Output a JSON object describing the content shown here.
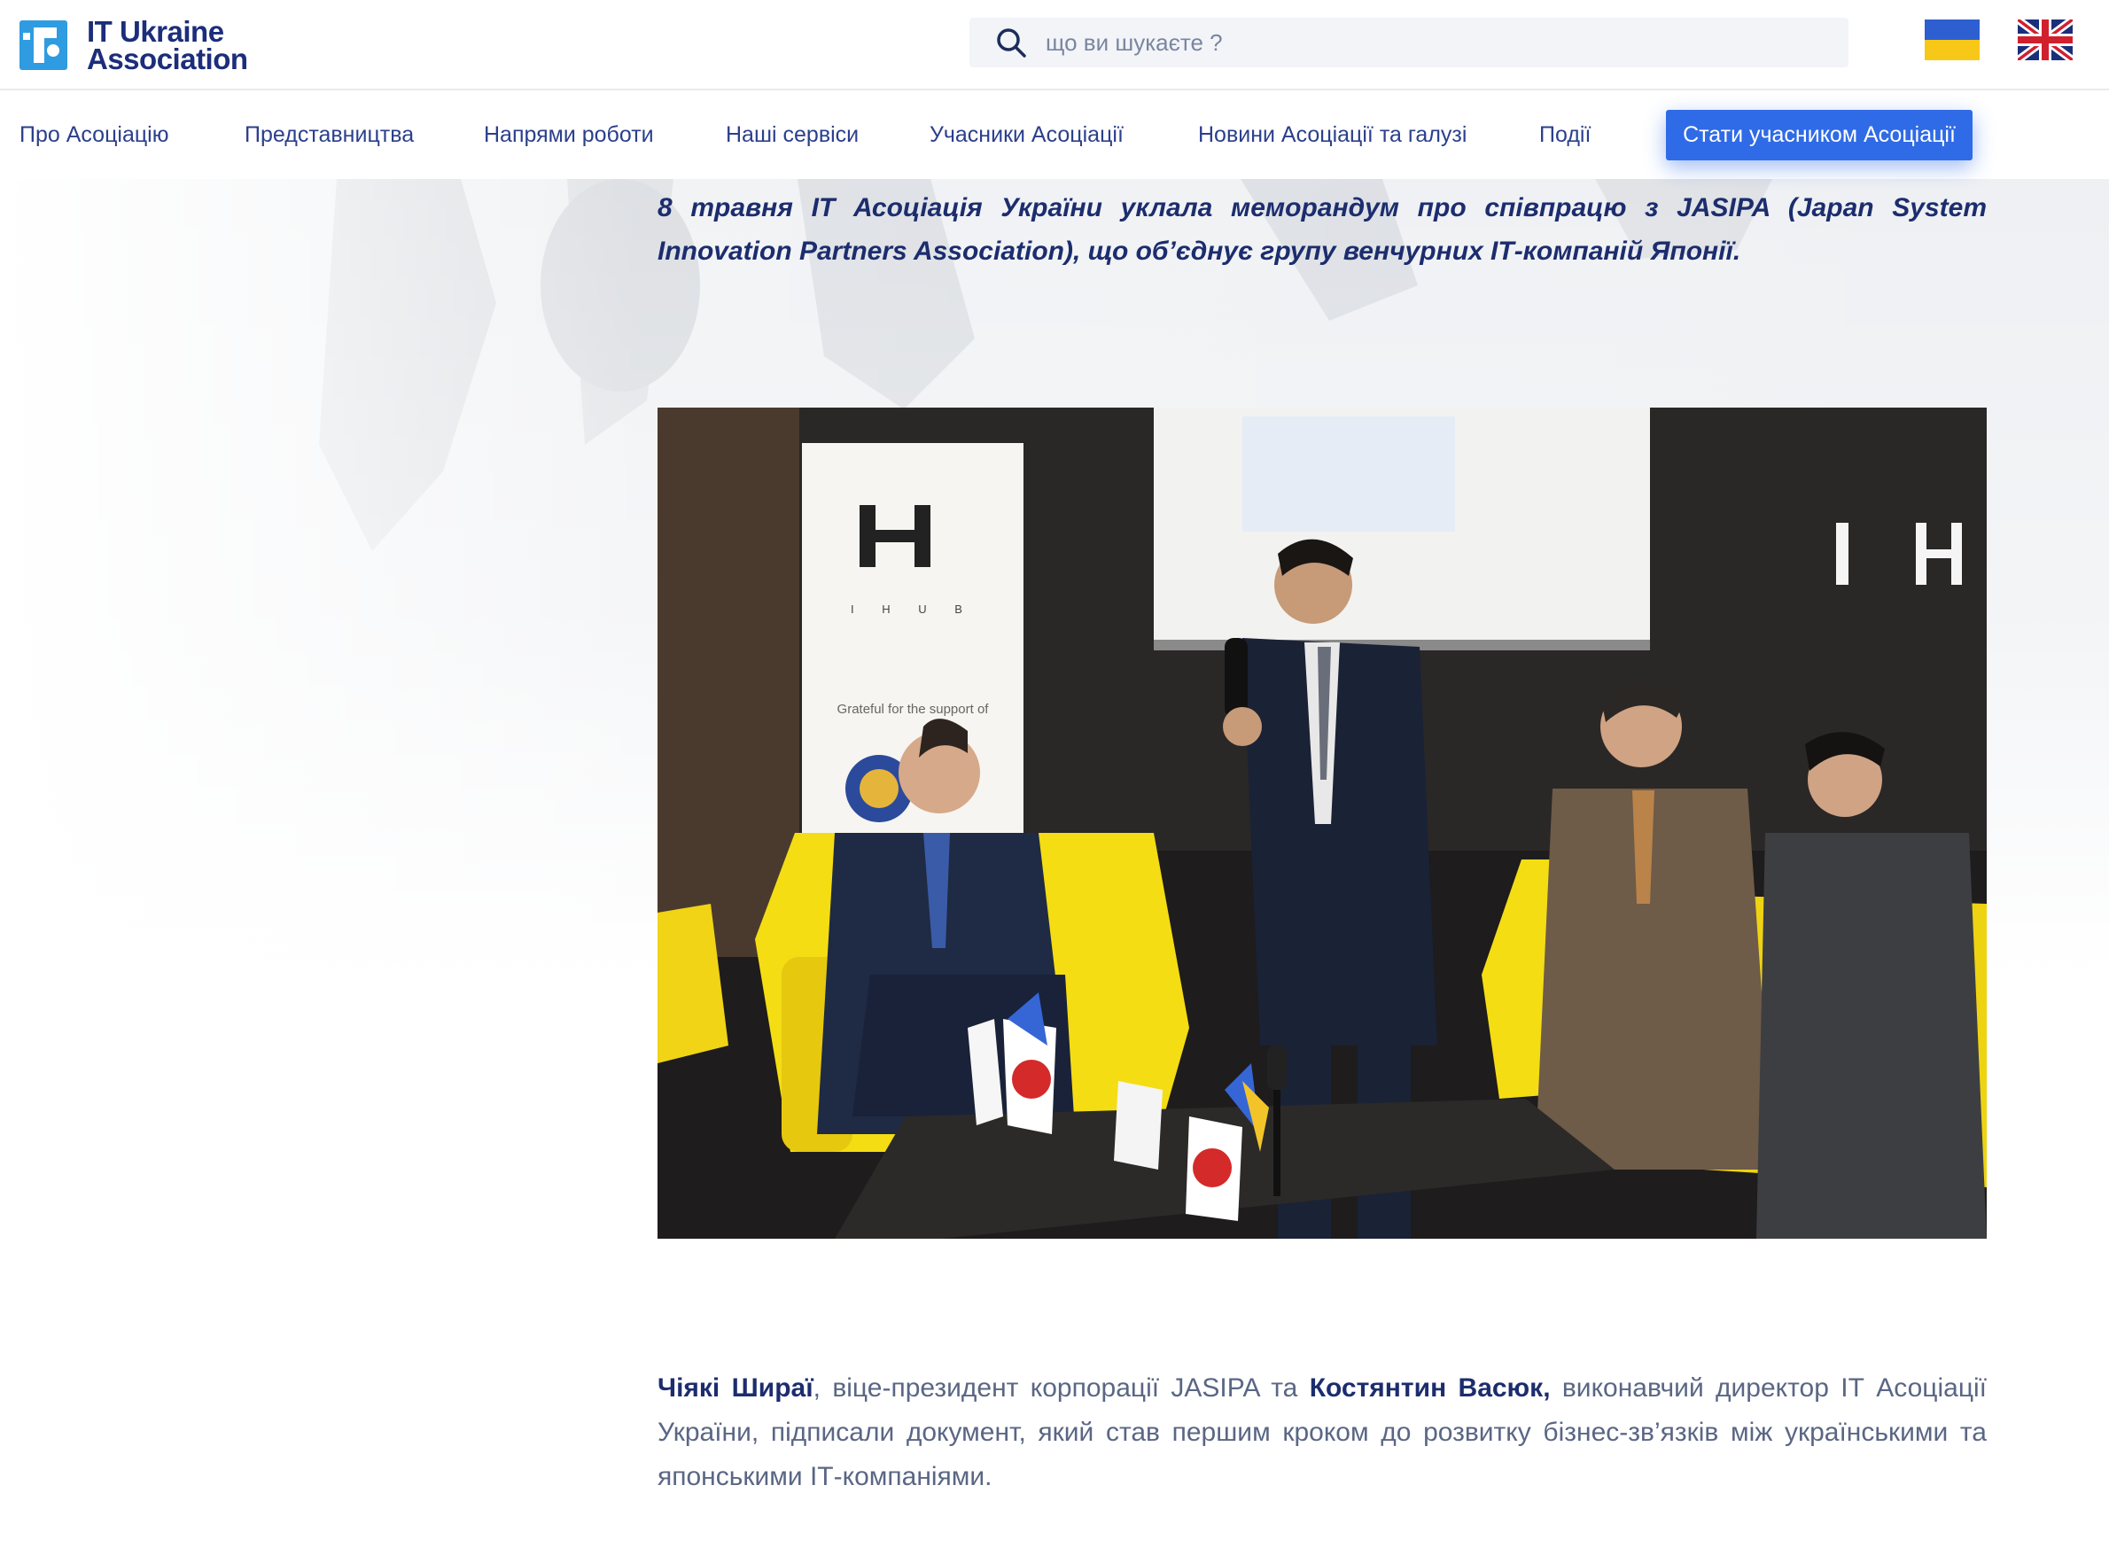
{
  "header": {
    "logo_line1": "IT Ukraine",
    "logo_line2": "Association",
    "search_placeholder": "що ви шукаєте ?",
    "flags": [
      "ukraine-flag-icon",
      "uk-flag-icon"
    ]
  },
  "nav": {
    "items": [
      "Про Асоціацію",
      "Представництва",
      "Напрями роботи",
      "Наші сервіси",
      "Учасники Асоціації",
      "Новини Асоціації та галузі",
      "Події"
    ],
    "cta": "Стати учасником Асоціації"
  },
  "article": {
    "lead": "8 травня ІТ Асоціація України уклала меморандум про співпрацю з JASIPA (Japan System Innovation Partners Association), що об’єднує групу венчурних ІТ-компаній Японії.",
    "photo_banner_letters": "I H U B",
    "photo_banner_caption": "Grateful for the support of",
    "body": {
      "name1": "Чіякі Шираї",
      "text1": ", віце-президент корпорації JASIPA та ",
      "name2": "Костянтин Васюк,",
      "text2": " виконавчий директор ІТ Асоціації України, підписали документ, який став першим кроком до розвитку бізнес-зв’язків між українськими та японськими ІТ-компаніями."
    }
  },
  "colors": {
    "brand": "#1c2d7a",
    "accent": "#2f6be6",
    "nav_text": "#2b3f8c",
    "body_text": "#5a6684"
  }
}
